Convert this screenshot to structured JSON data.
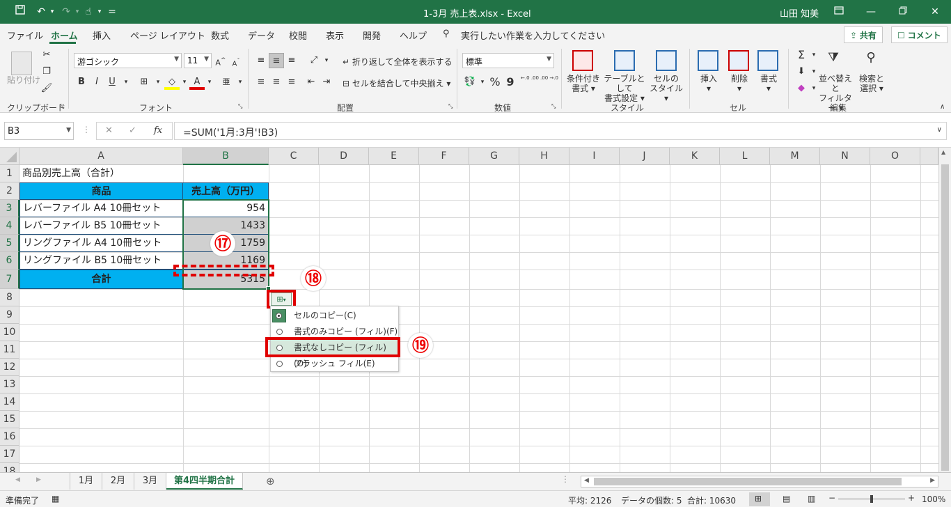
{
  "window": {
    "title": "1-3月 売上表.xlsx  -  Excel",
    "user": "山田 知美",
    "qat_more": "="
  },
  "tabs": [
    "ファイル",
    "ホーム",
    "挿入",
    "ページ レイアウト",
    "数式",
    "データ",
    "校閲",
    "表示",
    "開発",
    "ヘルプ"
  ],
  "tell_me": "実行したい作業を入力してください",
  "share_label": "共有",
  "comment_label": "コメント",
  "ribbon": {
    "clipboard": {
      "paste": "貼り付け",
      "label": "クリップボード"
    },
    "font": {
      "name": "游ゴシック",
      "size": "11",
      "bold": "B",
      "italic": "I",
      "underline": "U",
      "grow": "A",
      "shrink": "A",
      "font_color": "A",
      "phonetic": "亜",
      "label": "フォント"
    },
    "alignment": {
      "wrap": "折り返して全体を表示する",
      "merge": "セルを結合して中央揃え",
      "label": "配置"
    },
    "number": {
      "format": "標準",
      "percent": "%",
      "comma": "9",
      "inc": "←.0 .00",
      "dec": ".00 →.0",
      "label": "数値"
    },
    "styles": {
      "cond": "条件付き",
      "cond2": "書式",
      "table": "テーブルとして",
      "table2": "書式設定",
      "cell": "セルの",
      "cell2": "スタイル",
      "label": "スタイル"
    },
    "cells": {
      "insert": "挿入",
      "delete": "削除",
      "format": "書式",
      "label": "セル"
    },
    "editing": {
      "sum": "Σ",
      "sort": "並べ替えと",
      "sort2": "フィルター",
      "find": "検索と",
      "find2": "選択",
      "label": "編集"
    }
  },
  "formula_bar": {
    "name_box": "B3",
    "cancel": "✕",
    "enter": "✓",
    "fx": "fx",
    "formula": "=SUM('1月:3月'!B3)"
  },
  "columns": [
    "A",
    "B",
    "C",
    "D",
    "E",
    "F",
    "G",
    "H",
    "I",
    "J",
    "K",
    "L",
    "M",
    "N",
    "O"
  ],
  "rows": [
    "1",
    "2",
    "3",
    "4",
    "5",
    "6",
    "7",
    "8",
    "9",
    "10",
    "11",
    "12",
    "13",
    "14",
    "15",
    "16",
    "17",
    "18"
  ],
  "sheet": {
    "title": "商品別売上高（合計）",
    "header_product": "商品",
    "header_sales": "売上高（万円）",
    "items": [
      {
        "name": "レバーファイル A4 10冊セット",
        "value": "954"
      },
      {
        "name": "レバーファイル B5 10冊セット",
        "value": "1433"
      },
      {
        "name": "リングファイル A4 10冊セット",
        "value": "1759"
      },
      {
        "name": "リングファイル B5 10冊セット",
        "value": "1169"
      }
    ],
    "total_label": "合計",
    "total_value": "5315"
  },
  "badges": {
    "b17": "⑰",
    "b18": "⑱",
    "b19": "⑲"
  },
  "paste_menu": [
    {
      "label": "セルのコピー(C)",
      "selected": true
    },
    {
      "label": "書式のみコピー (フィル)(F)",
      "selected": false
    },
    {
      "label": "書式なしコピー (フィル)(O)",
      "selected": false
    },
    {
      "label": "フラッシュ フィル(E)",
      "selected": false
    }
  ],
  "sheet_tabs": [
    "1月",
    "2月",
    "3月",
    "第4四半期合計"
  ],
  "active_sheet": "第4四半期合計",
  "status": {
    "ready": "準備完了",
    "average": "平均: 2126",
    "count": "データの個数: 5",
    "sum": "合計: 10630",
    "zoom": "100%"
  },
  "colors": {
    "excel_green": "#217346",
    "header_fill": "#00b0f0",
    "highlight_red": "#e00000"
  }
}
